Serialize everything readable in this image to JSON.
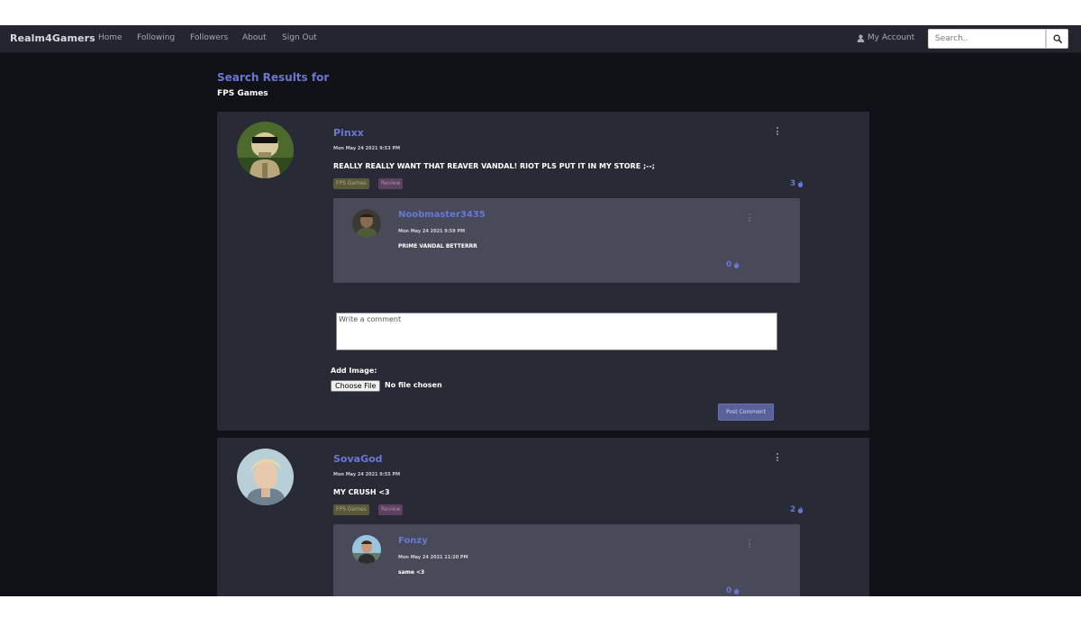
{
  "nav": {
    "brand": "Realm4Gamers",
    "links": [
      "Home",
      "Following",
      "Followers",
      "About",
      "Sign Out"
    ],
    "account_label": "My Account",
    "search_placeholder": "Search.."
  },
  "results": {
    "title": "Search Results for",
    "query": "FPS Games"
  },
  "posts": [
    {
      "author": "Pinxx",
      "date": "Mon May 24 2021 9:53 PM",
      "text": "REALLY REALLY WANT THAT REAVER VANDAL! RIOT PLS PUT IT IN MY STORE ;--;",
      "tags": [
        "FPS Games",
        "Review"
      ],
      "likes": "3",
      "replies": [
        {
          "author": "Noobmaster3435",
          "date": "Mon May 24 2021 9:59 PM",
          "text": "PRIME VANDAL BETTERRR",
          "likes": "0"
        }
      ],
      "comment_placeholder": "Write a comment",
      "add_image_label": "Add Image:",
      "choose_file_label": "Choose File",
      "no_file_text": "No file chosen",
      "post_comment_label": "Post Comment"
    },
    {
      "author": "SovaGod",
      "date": "Mon May 24 2021 9:55 PM",
      "text": "MY CRUSH <3",
      "tags": [
        "FPS Games",
        "Review"
      ],
      "likes": "2",
      "replies": [
        {
          "author": "Fonzy",
          "date": "Mon May 24 2021 11:20 PM",
          "text": "same <3",
          "likes": "0"
        }
      ]
    }
  ],
  "colors": {
    "accent": "#6a77d6",
    "background": "#111217",
    "card": "#282a35",
    "reply_card": "#484a5a",
    "navbar": "#24252f"
  },
  "icons": [
    "user-icon",
    "search-icon",
    "kebab-menu-icon",
    "flame-icon"
  ]
}
